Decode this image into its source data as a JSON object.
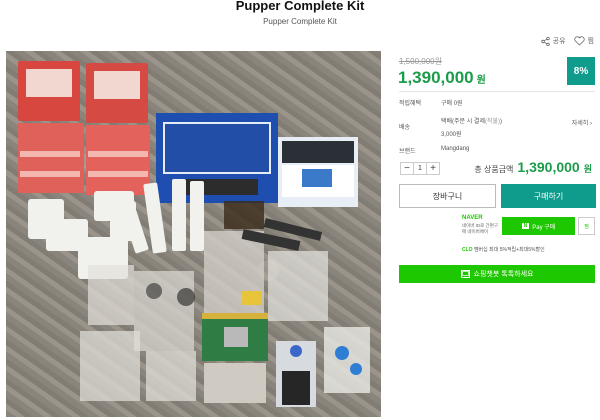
{
  "header": {
    "title": "Pupper Complete Kit",
    "subtitle": "Pupper Complete Kit"
  },
  "actions": {
    "share_label": "공유",
    "wish_label": "찜"
  },
  "pricing": {
    "original_price": "1,500,000원",
    "sale_price": "1,390,000",
    "sale_unit": "원",
    "discount": "8%"
  },
  "info": {
    "points_label": "적립혜택",
    "points_value": "구매 0원",
    "shipping_label": "배송",
    "shipping_method": "택배(주문 시 결제",
    "shipping_method_muted": "(착불)",
    "shipping_method_close": ")",
    "shipping_fee": "3,000원",
    "detail_link": "자세히",
    "brand_label": "브랜드",
    "brand_value": "Mangdang"
  },
  "quantity": {
    "minus": "−",
    "value": "1",
    "plus": "+"
  },
  "total": {
    "label": "총 상품금액",
    "value": "1,390,000",
    "unit": "원"
  },
  "buttons": {
    "cart": "장바구니",
    "buy": "구매하기",
    "talk": "쇼핑챗봇 톡톡하세요"
  },
  "npay": {
    "brand": "NAVER",
    "desc": "네이버 ID로 간편구매 네이버페이",
    "pay_badge": "N",
    "pay_label": "Pay 구매",
    "wish": "찜",
    "note_brand": "CLO",
    "note_text": "멤버십 최대 5%적립+최대5%할인"
  },
  "colors": {
    "accent": "#0f9c8c",
    "price": "#1b9c4a",
    "naver": "#1ec800"
  }
}
